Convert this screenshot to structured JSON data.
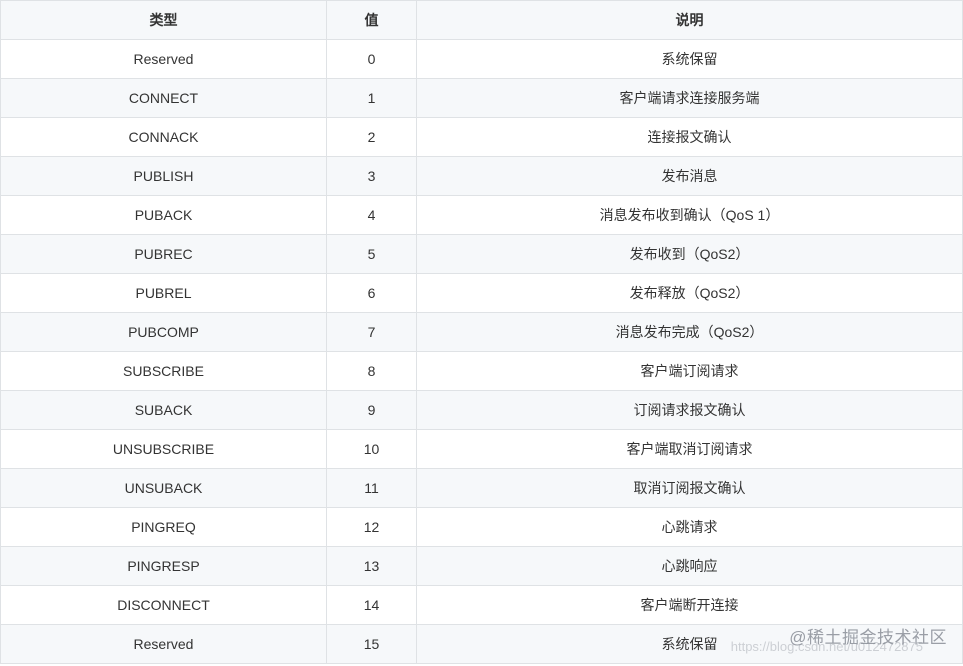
{
  "table": {
    "headers": [
      "类型",
      "值",
      "说明"
    ],
    "rows": [
      [
        "Reserved",
        "0",
        "系统保留"
      ],
      [
        "CONNECT",
        "1",
        "客户端请求连接服务端"
      ],
      [
        "CONNACK",
        "2",
        "连接报文确认"
      ],
      [
        "PUBLISH",
        "3",
        "发布消息"
      ],
      [
        "PUBACK",
        "4",
        "消息发布收到确认（QoS 1）"
      ],
      [
        "PUBREC",
        "5",
        "发布收到（QoS2）"
      ],
      [
        "PUBREL",
        "6",
        "发布释放（QoS2）"
      ],
      [
        "PUBCOMP",
        "7",
        "消息发布完成（QoS2）"
      ],
      [
        "SUBSCRIBE",
        "8",
        "客户端订阅请求"
      ],
      [
        "SUBACK",
        "9",
        "订阅请求报文确认"
      ],
      [
        "UNSUBSCRIBE",
        "10",
        "客户端取消订阅请求"
      ],
      [
        "UNSUBACK",
        "11",
        "取消订阅报文确认"
      ],
      [
        "PINGREQ",
        "12",
        "心跳请求"
      ],
      [
        "PINGRESP",
        "13",
        "心跳响应"
      ],
      [
        "DISCONNECT",
        "14",
        "客户端断开连接"
      ],
      [
        "Reserved",
        "15",
        "系统保留"
      ]
    ]
  },
  "watermark": {
    "text": "@稀土掘金技术社区",
    "sub": "https://blog.csdn.net/u012472875"
  }
}
